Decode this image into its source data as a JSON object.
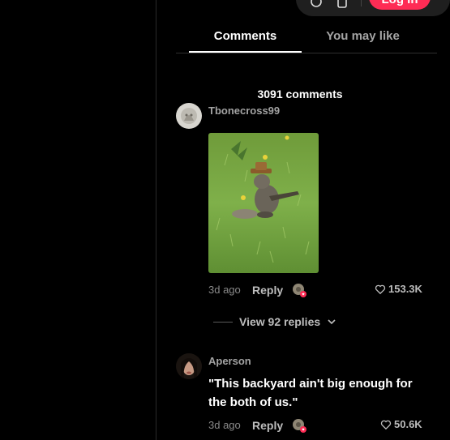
{
  "header": {
    "login_label": "Log in",
    "icons": [
      "coin-icon",
      "device-icon"
    ]
  },
  "tabs": [
    {
      "label": "Comments",
      "active": true
    },
    {
      "label": "You may like",
      "active": false
    }
  ],
  "comments_count_text": "3091 comments",
  "comments": [
    {
      "username": "Tbonecross99",
      "has_image": true,
      "time": "3d ago",
      "reply_label": "Reply",
      "likes": "153.3K",
      "view_replies_label": "View 92 replies"
    },
    {
      "username": "Aperson",
      "text": "\"This backyard ain't big enough for the both of us.\"",
      "time": "3d ago",
      "reply_label": "Reply",
      "likes": "50.6K"
    }
  ],
  "colors": {
    "background": "#000000",
    "accent": "#fe2c55",
    "muted_text": "#a3a3a3"
  }
}
